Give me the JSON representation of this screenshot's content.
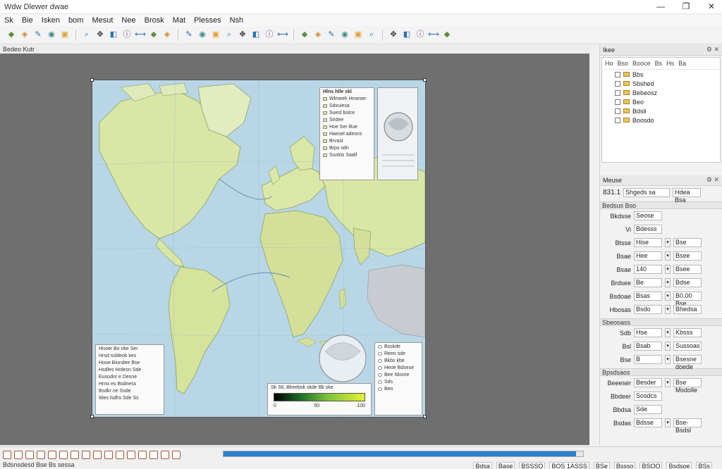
{
  "window": {
    "title": "Wdw Dlewer dwae",
    "controls": [
      "—",
      "❐",
      "✕"
    ]
  },
  "menu": [
    "Sk",
    "Bie",
    "Isken",
    "bom",
    "Mesut",
    "Nee",
    "Brosk",
    "Mat",
    "Plesses",
    "Nsh"
  ],
  "toolbar": {
    "icons": [
      "layer-icon",
      "open-icon",
      "save-icon",
      "globe-icon",
      "folder-icon",
      "zoom-icon",
      "pan-icon",
      "select-icon",
      "identify-icon",
      "measure-icon",
      "node-icon",
      "edit-icon",
      "digitize-icon",
      "split-icon",
      "merge-icon",
      "label-icon",
      "style-icon",
      "table-icon",
      "filter-icon",
      "query-icon",
      "buffer-icon",
      "clip-icon",
      "dissolve-icon",
      "grid-icon",
      "raster-icon",
      "vector-icon",
      "print-icon",
      "export-icon",
      "python-icon",
      "plugin-icon",
      "help-icon"
    ]
  },
  "canvas": {
    "label": "Bedeo Kutr"
  },
  "map": {
    "legend_top": {
      "title": "Hlns hlle skl",
      "items": [
        "Wlmeeh Hroeser",
        "Sdxuiesa",
        "Suesl bolce",
        "Sirdee",
        "Hoe Ser Bue",
        "Haesel adesns",
        "Brvasl",
        "Brps sdn",
        "Suolos Saalf"
      ]
    },
    "legend_bottom_left": {
      "rows": [
        "Hnoer Bo nke Ser",
        "Hrsd ssldeok kes",
        "Hooe Biondee Bse",
        "Hsdles Hrdesn Sde",
        "Eusodnr e Desne",
        "Hrno es Bsdness",
        "Bsdkr ne Ssde",
        "Wes lsdhs Sde Ss"
      ]
    },
    "legend_bottom_right": {
      "items": [
        "Bsskde",
        "Reeo sde",
        "Bkbs kbe",
        "Heoe Bdsese",
        "Bee Idosne",
        "Sds",
        "Beo"
      ]
    },
    "colorbar": {
      "title": "Sk Stl, Bkeebsk skde Bk ske",
      "ticks": [
        "0",
        "50",
        "100"
      ]
    }
  },
  "dock": {
    "layers": {
      "title": "Ikee",
      "toolbar": [
        "Ho",
        "Bso",
        "Booce",
        "Bs",
        "Hs",
        "Ba"
      ],
      "nodes": [
        "Bbs",
        "Sbshed",
        "Bebeosz",
        "Beo",
        "Bdsli",
        "Boosdo"
      ]
    },
    "properties": {
      "title": "Meuse",
      "coords_label": "831.1",
      "coords_value": "Shgeds sa",
      "coords_scale": "Hdea Bsa",
      "section1": "Bedsus Bso",
      "rows1": [
        {
          "label": "Bkdsse",
          "value": "Seose"
        },
        {
          "label": "Vi",
          "value": "Bdesss"
        },
        {
          "label": "Btsse",
          "value": "Hise",
          "value2": "Bse"
        },
        {
          "label": "Bsae",
          "value": "Hee",
          "value2": "Bsee"
        },
        {
          "label": "Bsae",
          "value": "140",
          "value2": "Bsee"
        },
        {
          "label": "Brdsee",
          "value": "Be",
          "value2": "Bdse"
        },
        {
          "label": "Bsdoae",
          "value": "Bsas",
          "value2": "B0.00 Bse"
        },
        {
          "label": "Hbosas",
          "value": "Bsdo",
          "value2": "Bhedsa"
        }
      ],
      "section2": "Sbeooass",
      "rows2": [
        {
          "label": "Sdb",
          "value": "Hse",
          "value2": "Kbsss"
        },
        {
          "label": "Bsl",
          "value": "Bsab",
          "value2": "Sussoas"
        },
        {
          "label": "Bse",
          "value": "B",
          "value2": "Bsesne doede"
        }
      ],
      "section3": "Bpsdsaos",
      "rows3": [
        {
          "label": "Beeeser",
          "value": "Besder",
          "value2": "Bse Msdolle"
        },
        {
          "label": "Bbdeer",
          "value": "Sosdcs"
        },
        {
          "label": "Bbdsa",
          "value": "Sde"
        },
        {
          "label": "Bsdas",
          "value": "Bdsse",
          "value2": "Bse-Bsdsl"
        }
      ]
    }
  },
  "status": {
    "progress_pct": 98,
    "message": "Bdsnsdesd Bse Bs sessa",
    "right_items": [
      "Bdsa",
      "Base",
      "BSSSO",
      "BOS 1ASSS",
      "BSe",
      "Bssso",
      "BSOO",
      "Bsdsoe",
      "BSs"
    ]
  }
}
